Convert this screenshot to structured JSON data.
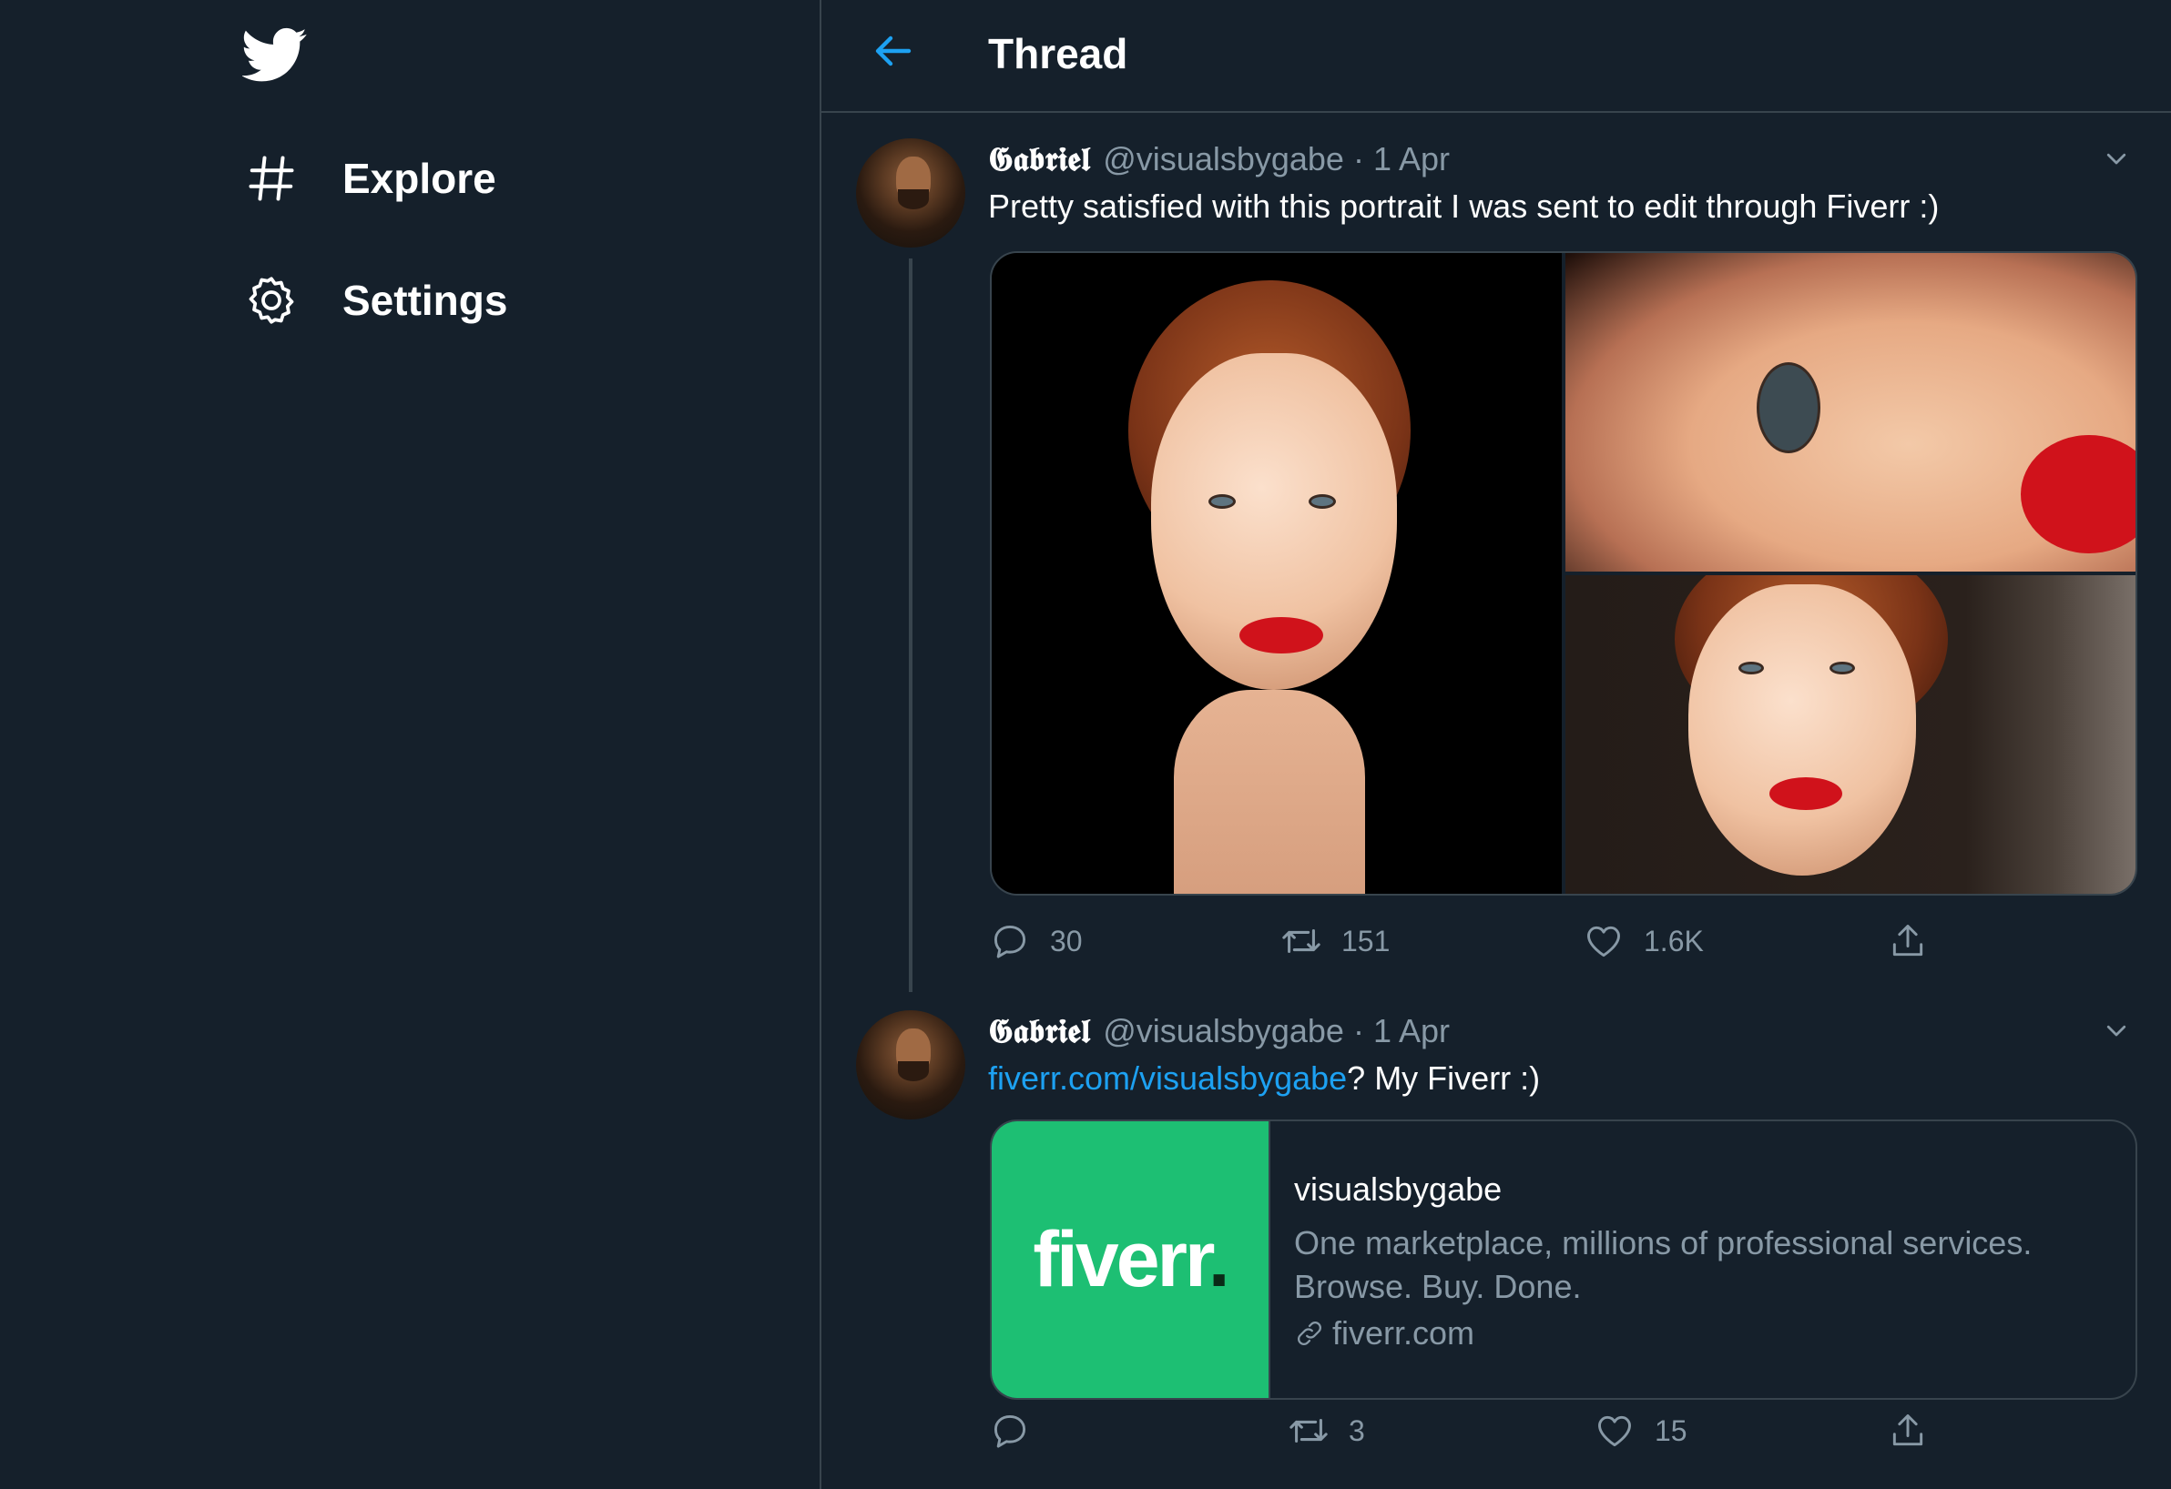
{
  "nav": {
    "logo_icon": "twitter-bird-icon",
    "items": [
      {
        "label": "Explore",
        "icon": "hashtag-icon"
      },
      {
        "label": "Settings",
        "icon": "gear-icon"
      }
    ]
  },
  "header": {
    "title": "Thread",
    "back_icon": "back-arrow-icon"
  },
  "colors": {
    "background": "#15202b",
    "border": "#38444d",
    "accent": "#1da1f2",
    "muted": "#8899a6",
    "fiverr_green": "#1dbf73"
  },
  "tweets": [
    {
      "name": "𝕲𝖆𝖇𝖗𝖎𝖊𝖑",
      "handle": "@visualsbygabe",
      "separator": "·",
      "date": "1 Apr",
      "text": "Pretty satisfied with this portrait I was sent to edit through Fiverr :)",
      "media_count": 3,
      "replies": "30",
      "retweets": "151",
      "likes": "1.6K"
    },
    {
      "name": "𝕲𝖆𝖇𝖗𝖎𝖊𝖑",
      "handle": "@visualsbygabe",
      "separator": "·",
      "date": "1 Apr",
      "link_text": "fiverr.com/visualsbygabe",
      "text_suffix": "? My Fiverr :)",
      "card": {
        "logo_text": "fiverr",
        "logo_dot": ".",
        "title": "visualsbygabe",
        "description": "One marketplace, millions of professional services. Browse. Buy. Done.",
        "domain": "fiverr.com"
      },
      "replies": "",
      "retweets": "3",
      "likes": "15"
    }
  ]
}
